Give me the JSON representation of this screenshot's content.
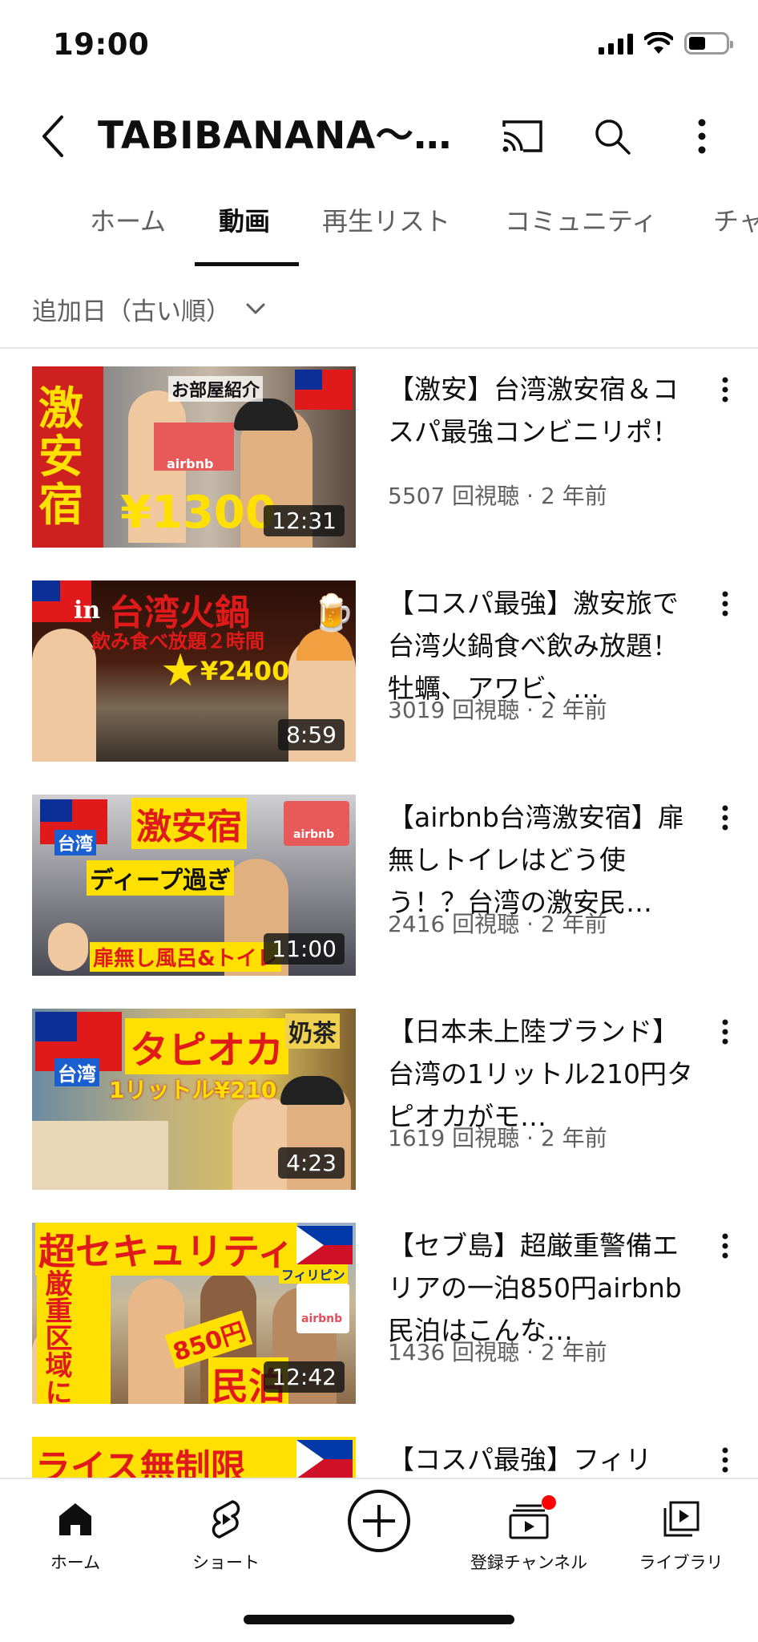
{
  "status_bar": {
    "time": "19:00"
  },
  "header": {
    "channel_title": "TABIBANANA〜…"
  },
  "tabs": [
    {
      "label": "ホーム"
    },
    {
      "label": "動画"
    },
    {
      "label": "再生リスト"
    },
    {
      "label": "コミュニティ"
    },
    {
      "label": "チャ"
    }
  ],
  "active_tab": "動画",
  "sort": {
    "label": "追加日（古い順）"
  },
  "videos": [
    {
      "title": "【激安】台湾激安宿＆コスパ最強コンビニリポ！",
      "meta": "5507 回視聴 · 2 年前",
      "duration": "12:31",
      "thumb_text": [
        "激",
        "安",
        "宿",
        "¥1300",
        "お部屋紹介",
        "airbnb"
      ]
    },
    {
      "title": "【コスパ最強】激安旅で台湾火鍋食べ飲み放題！牡蠣、アワビ、…",
      "meta": "3019 回視聴 · 2 年前",
      "duration": "8:59",
      "thumb_text": [
        "台湾火鍋",
        "飲み食べ放題２時間",
        "¥2400",
        "in"
      ]
    },
    {
      "title": "【airbnb台湾激安宿】扉無しトイレはどう使う！？台湾の激安民…",
      "meta": "2416 回視聴 · 2 年前",
      "duration": "11:00",
      "thumb_text": [
        "激安宿",
        "台湾",
        "ディープ過ぎ",
        "扉無し風呂&トイレ",
        "airbnb"
      ]
    },
    {
      "title": "【日本未上陸ブランド】台湾の1リットル210円タピオカがモ…",
      "meta": "1619 回視聴 · 2 年前",
      "duration": "4:23",
      "thumb_text": [
        "タピオカ",
        "台湾",
        "1リットル¥210",
        "奶茶"
      ]
    },
    {
      "title": "【セブ島】超厳重警備エリアの一泊850円airbnb民泊はこんな…",
      "meta": "1436 回視聴 · 2 年前",
      "duration": "12:42",
      "thumb_text": [
        "超セキュリティ",
        "厳重区域にある",
        "850円",
        "民泊",
        "フィリピン",
        "airbnb"
      ]
    },
    {
      "title": "【コスパ最強】フィリ",
      "meta": "",
      "duration": "",
      "thumb_text": [
        "ライス無制限"
      ]
    }
  ],
  "bottom_nav": [
    {
      "label": "ホーム",
      "icon": "home-icon"
    },
    {
      "label": "ショート",
      "icon": "shorts-icon"
    },
    {
      "label": "",
      "icon": "create-icon"
    },
    {
      "label": "登録チャンネル",
      "icon": "subscriptions-icon"
    },
    {
      "label": "ライブラリ",
      "icon": "library-icon"
    }
  ],
  "colors": {
    "accent": "#0f0f0f",
    "secondary_text": "#606060",
    "notification_dot": "#ff0000"
  }
}
